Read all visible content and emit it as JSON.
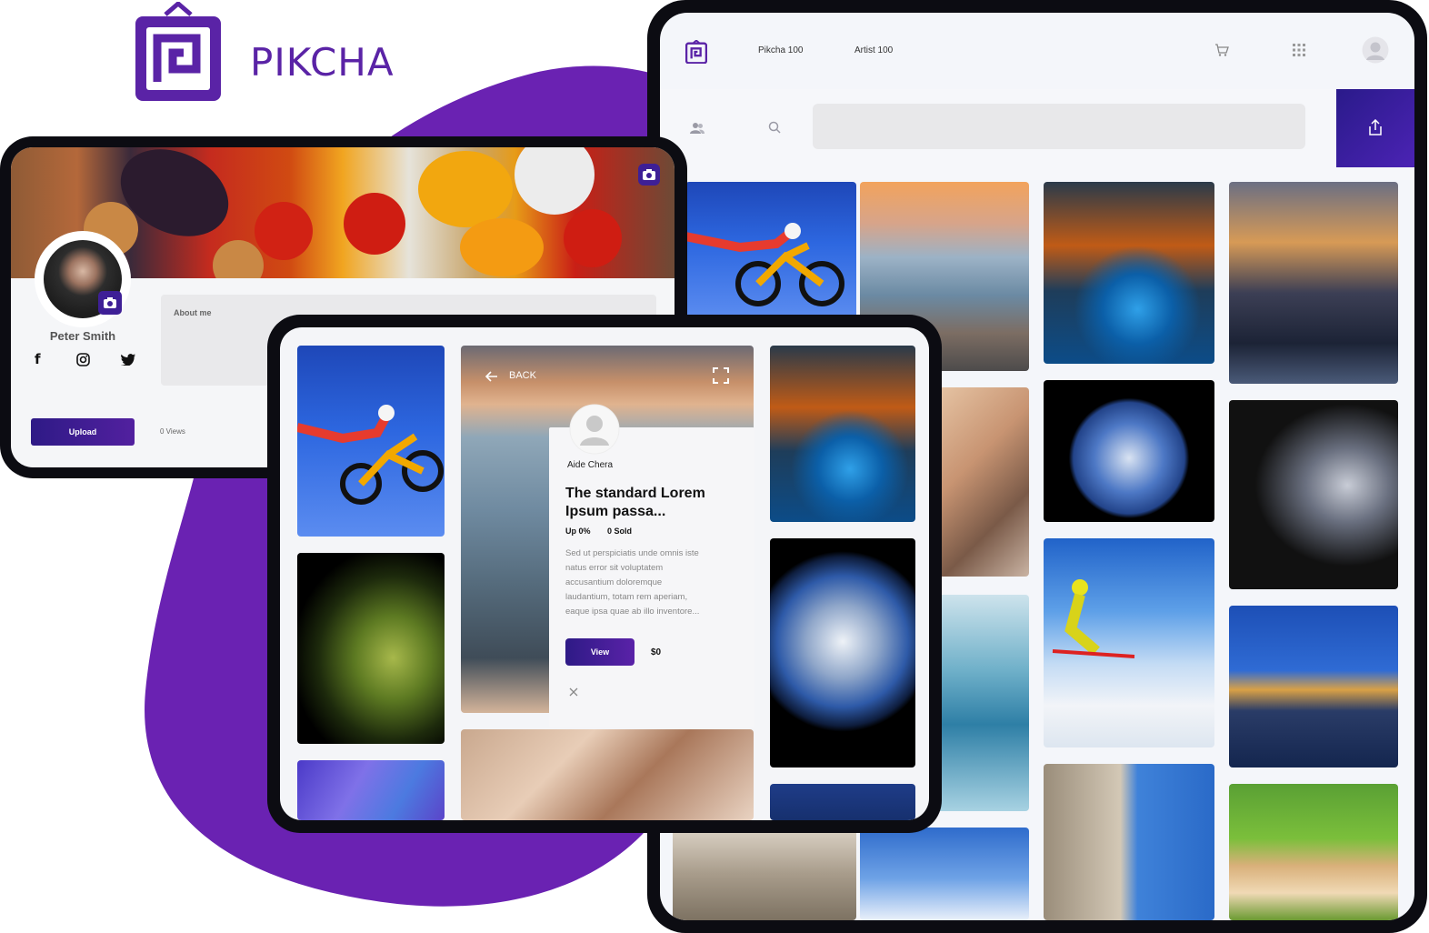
{
  "brand": {
    "name": "PIKCHA",
    "color": "#5a23a6"
  },
  "colors": {
    "accent": "#3e1f96",
    "accent_light": "#6a2fc9",
    "blob": "#6a22b2",
    "device": "#0c0c12"
  },
  "right_tablet": {
    "nav": {
      "item1": "Pikcha 100",
      "item2": "Artist 100"
    },
    "icons": [
      "logo-icon",
      "cart-icon",
      "grid-icon",
      "avatar-icon",
      "people-icon",
      "search-icon",
      "upload-icon"
    ],
    "search": {
      "value": ""
    }
  },
  "profile_tablet": {
    "name": "Peter Smith",
    "about_label": "About me",
    "upload_label": "Upload",
    "views": "0 Views",
    "icons": [
      "facebook-icon",
      "instagram-icon",
      "twitter-icon",
      "camera-icon"
    ]
  },
  "detail_tablet": {
    "back_label": "BACK",
    "artist": "Aide Chera",
    "title_line1": "The standard Lorem",
    "title_line2": "Ipsum passa...",
    "up": "Up 0%",
    "sold": "0 Sold",
    "description": [
      "Sed ut perspiciatis unde omnis iste",
      "natus error sit voluptatem",
      "accusantium doloremque",
      "laudantium, totam rem aperiam,",
      "eaque ipsa quae ab illo inventore..."
    ],
    "view_label": "View",
    "price": "$0"
  }
}
